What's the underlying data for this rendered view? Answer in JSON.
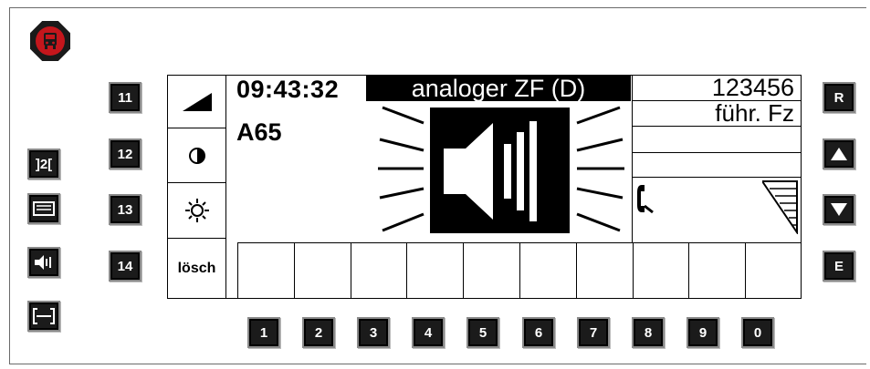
{
  "display": {
    "time": "09:43:32",
    "mode_title": "analoger ZF (D)",
    "line": "A65",
    "radio_id": "123456",
    "vehicle_role": "führ. Fz",
    "clear_label": "lösch",
    "message_cells": [
      "",
      "",
      "",
      "",
      "",
      "",
      "",
      "",
      "",
      ""
    ]
  },
  "keys": {
    "left_numbered": [
      "11",
      "12",
      "13",
      "14"
    ],
    "bottom_digits": [
      "1",
      "2",
      "3",
      "4",
      "5",
      "6",
      "7",
      "8",
      "9",
      "0"
    ],
    "right": {
      "r_label": "R",
      "e_label": "E"
    },
    "side_code_label": "]2["
  },
  "colors": {
    "alarm": "#c4161c",
    "key": "#1b1b1b",
    "title_bar": "#000000"
  },
  "icons": {
    "alarm": "bus-alarm-icon",
    "volume": "volume-ramp-icon",
    "contrast": "contrast-icon",
    "brightness": "brightness-icon",
    "speaker": "loudspeaker-icon",
    "phone": "phone-handset-icon",
    "signal": "signal-strength-icon",
    "up": "arrow-up-icon",
    "down": "arrow-down-icon"
  }
}
